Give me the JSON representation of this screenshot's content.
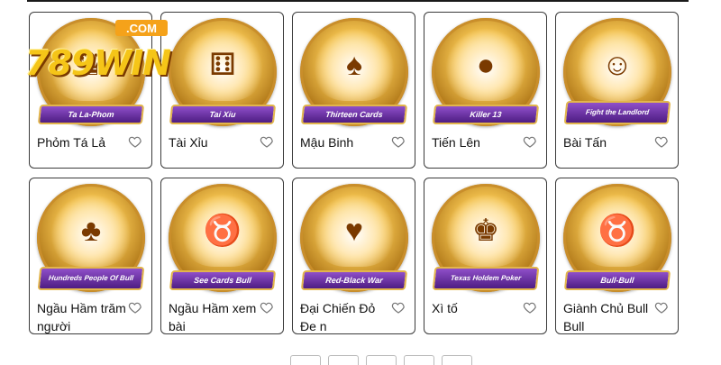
{
  "logo": {
    "mark": "789WIN",
    "com": ".COM"
  },
  "games": [
    {
      "title": "Phỏm Tá Lả",
      "banner": "Ta La-Phom",
      "icon": "crown-logo-icon"
    },
    {
      "title": "Tài Xỉu",
      "banner": "Tai Xiu",
      "icon": "dice-cup-icon"
    },
    {
      "title": "Mậu Binh",
      "banner": "Thirteen Cards",
      "icon": "revolver-cards-icon"
    },
    {
      "title": "Tiến Lên",
      "banner": "Killer 13",
      "icon": "bomb-cards-icon"
    },
    {
      "title": "Bài Tấn",
      "banner": "Fight the Landlord",
      "icon": "landlord-character-icon"
    },
    {
      "title": "Ngầu Hầm trăm người",
      "banner": "Hundreds People Of Bull",
      "icon": "bull-hat-icon"
    },
    {
      "title": "Ngầu Hầm xem bài",
      "banner": "See Cards Bull",
      "icon": "bull-character-icon"
    },
    {
      "title": "Đại Chiến Đỏ Đe n",
      "banner": "Red-Black War",
      "icon": "vs-cards-icon"
    },
    {
      "title": "Xì tố",
      "banner": "Texas Holdem Poker",
      "icon": "crown-cards-icon"
    },
    {
      "title": "Giành Chủ Bull Bull",
      "banner": "Bull-Bull",
      "icon": "gold-bull-icon"
    }
  ],
  "colors": {
    "ribbon": "#6a2fa6",
    "gold": "#e2b54b",
    "border": "#3a3a3a"
  }
}
